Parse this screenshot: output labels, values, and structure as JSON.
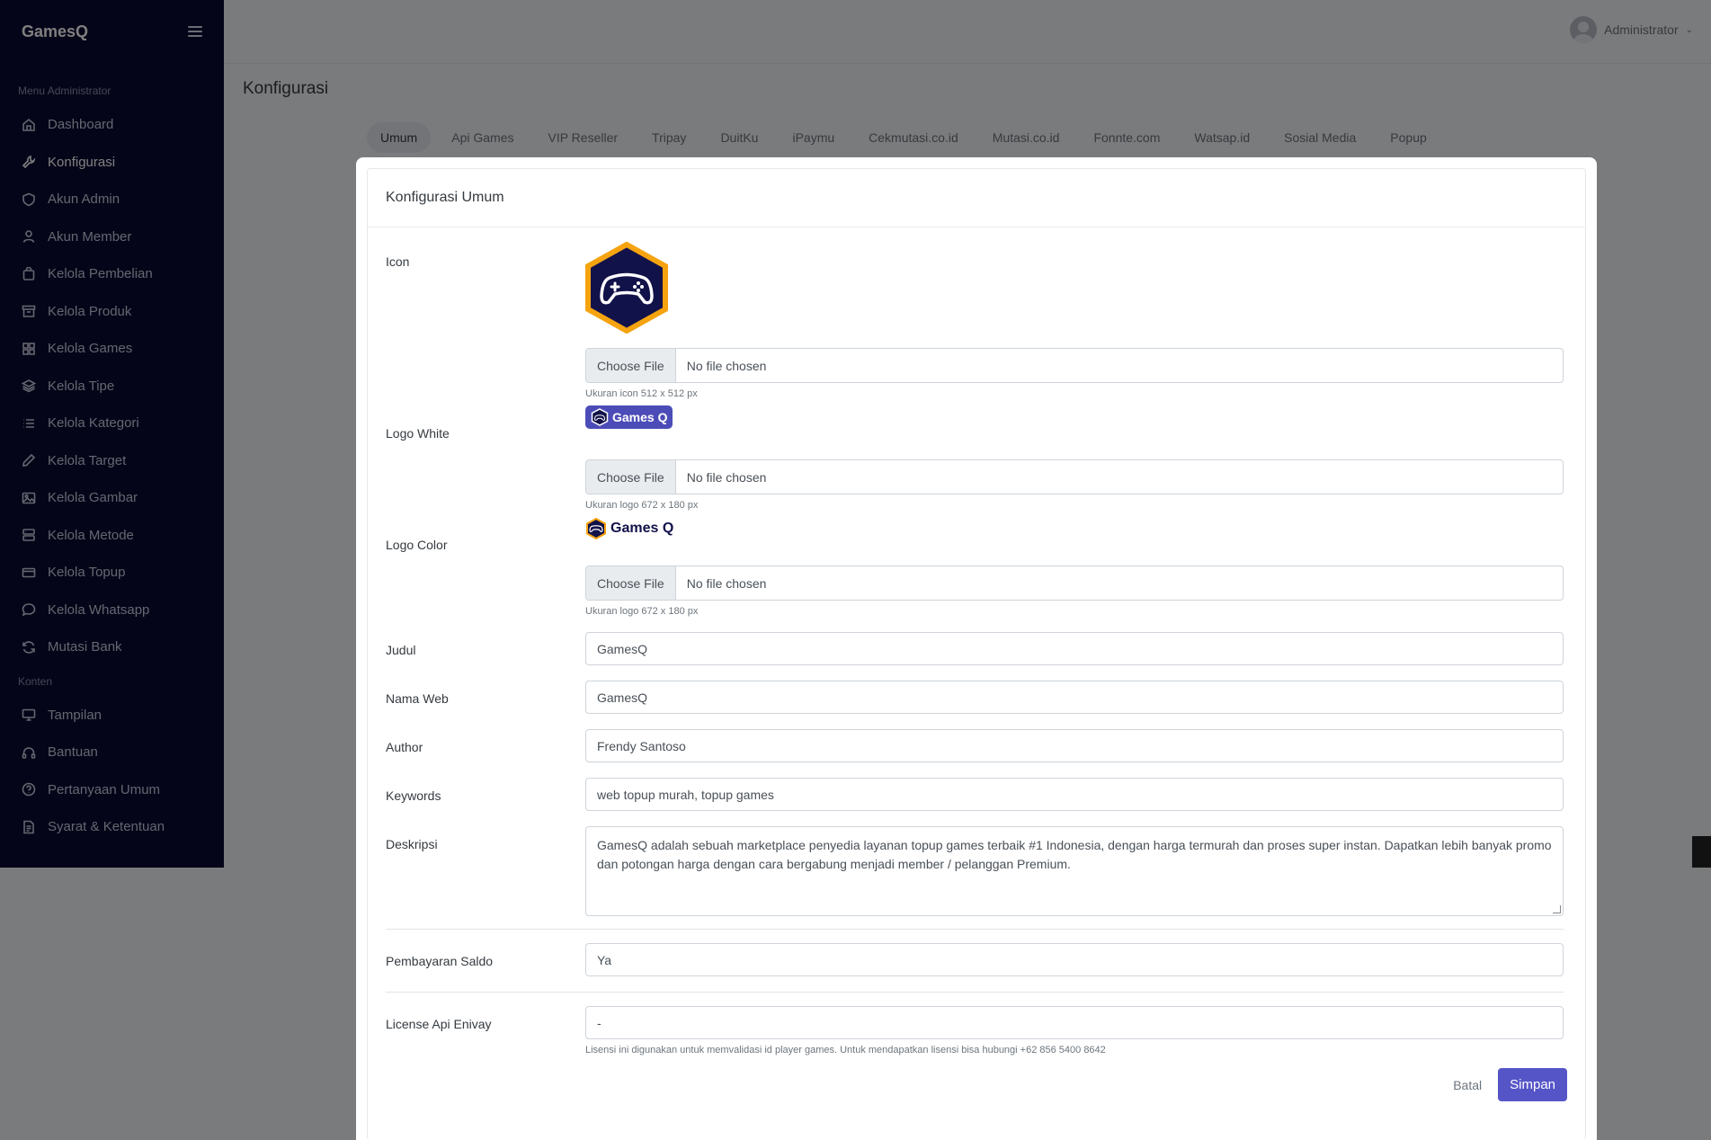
{
  "brand": {
    "name": "GamesQ"
  },
  "sidebar": {
    "section_admin": "Menu Administrator",
    "section_content": "Konten",
    "admin_items": [
      {
        "label": "Dashboard",
        "icon": "home-icon"
      },
      {
        "label": "Konfigurasi",
        "icon": "wrench-icon",
        "active": true
      },
      {
        "label": "Akun Admin",
        "icon": "shield-icon"
      },
      {
        "label": "Akun Member",
        "icon": "user-icon"
      },
      {
        "label": "Kelola Pembelian",
        "icon": "bag-icon"
      },
      {
        "label": "Kelola Produk",
        "icon": "archive-icon"
      },
      {
        "label": "Kelola Games",
        "icon": "grid-icon"
      },
      {
        "label": "Kelola Tipe",
        "icon": "layers-icon"
      },
      {
        "label": "Kelola Kategori",
        "icon": "list-icon"
      },
      {
        "label": "Kelola Target",
        "icon": "edit-icon"
      },
      {
        "label": "Kelola Gambar",
        "icon": "image-icon"
      },
      {
        "label": "Kelola Metode",
        "icon": "server-icon"
      },
      {
        "label": "Kelola Topup",
        "icon": "card-icon"
      },
      {
        "label": "Kelola Whatsapp",
        "icon": "chat-icon"
      },
      {
        "label": "Mutasi Bank",
        "icon": "refresh-icon"
      }
    ],
    "content_items": [
      {
        "label": "Tampilan",
        "icon": "monitor-icon"
      },
      {
        "label": "Bantuan",
        "icon": "headphones-icon"
      },
      {
        "label": "Pertanyaan Umum",
        "icon": "help-icon"
      },
      {
        "label": "Syarat & Ketentuan",
        "icon": "file-icon"
      }
    ]
  },
  "header": {
    "user": "Administrator"
  },
  "page": {
    "title": "Konfigurasi"
  },
  "tabs": [
    "Umum",
    "Api Games",
    "VIP Reseller",
    "Tripay",
    "DuitKu",
    "iPaymu",
    "Cekmutasi.co.id",
    "Mutasi.co.id",
    "Fonnte.com",
    "Watsap.id",
    "Sosial Media",
    "Popup"
  ],
  "form": {
    "title": "Konfigurasi Umum",
    "file_button": "Choose File",
    "file_empty": "No file chosen",
    "icon": {
      "label": "Icon",
      "hint": "Ukuran icon 512 x 512 px"
    },
    "logo_white": {
      "label": "Logo White",
      "hint": "Ukuran logo 672 x 180 px",
      "text": "Games Q"
    },
    "logo_color": {
      "label": "Logo Color",
      "hint": "Ukuran logo 672 x 180 px",
      "text": "Games Q"
    },
    "judul": {
      "label": "Judul",
      "value": "GamesQ"
    },
    "nama_web": {
      "label": "Nama Web",
      "value": "GamesQ"
    },
    "author": {
      "label": "Author",
      "value": "Frendy Santoso"
    },
    "keywords": {
      "label": "Keywords",
      "value": "web topup murah, topup games"
    },
    "deskripsi": {
      "label": "Deskripsi",
      "value": "GamesQ adalah sebuah marketplace penyedia layanan topup games terbaik #1 Indonesia, dengan harga termurah dan proses super instan. Dapatkan lebih banyak promo dan potongan harga dengan cara bergabung menjadi member / pelanggan Premium."
    },
    "pembayaran_saldo": {
      "label": "Pembayaran Saldo",
      "value": "Ya"
    },
    "license": {
      "label": "License Api Enivay",
      "value": "-",
      "hint": "Lisensi ini digunakan untuk memvalidasi id player games. Untuk mendapatkan lisensi bisa hubungi +62 856 5400 8642"
    },
    "cancel_label": "Batal",
    "save_label": "Simpan"
  },
  "colors": {
    "sidebar": "#0b0a33",
    "primary": "#5555c8",
    "logo_orange": "#f5a30f",
    "logo_navy": "#12124a"
  }
}
